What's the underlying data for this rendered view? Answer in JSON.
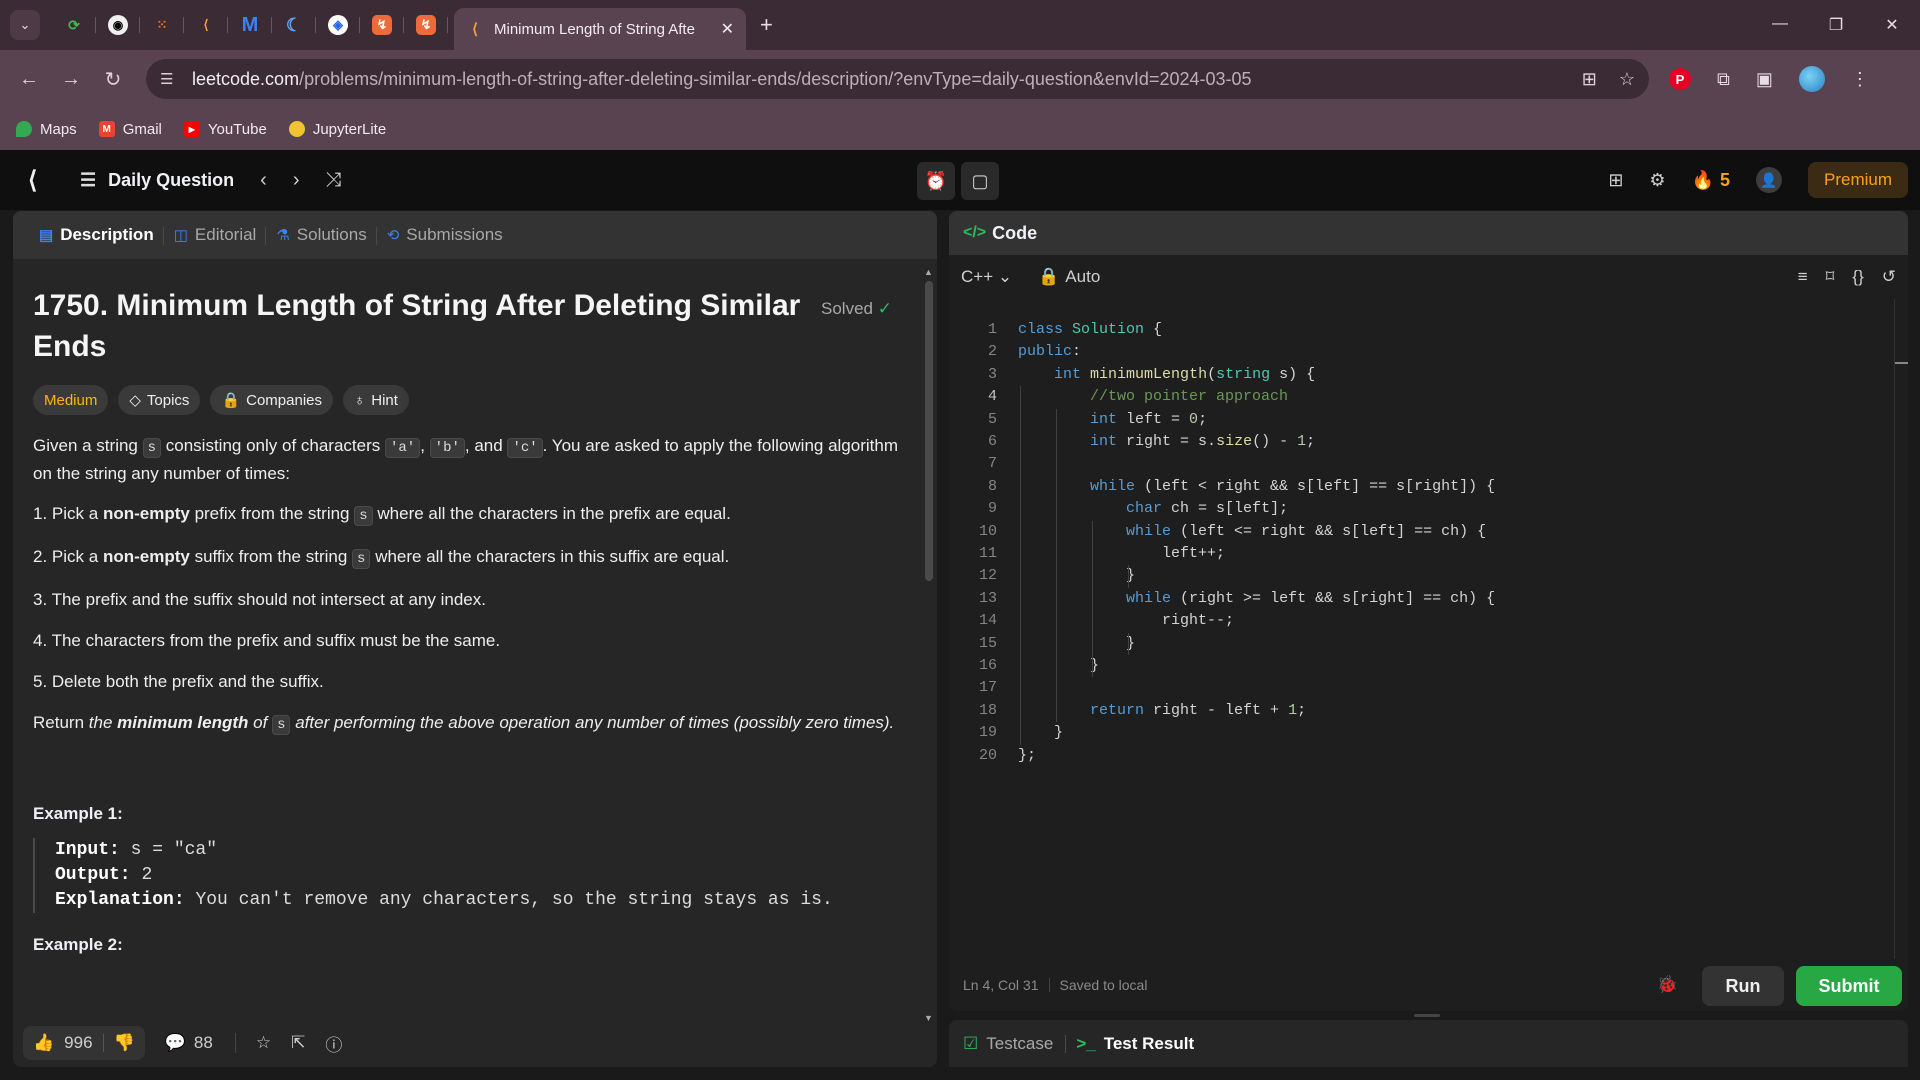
{
  "browser": {
    "tab_title": "Minimum Length of String Afte",
    "url_host": "leetcode.com",
    "url_path": "/problems/minimum-length-of-string-after-deleting-similar-ends/description/?envType=daily-question&envId=2024-03-05",
    "bookmarks": [
      "Maps",
      "Gmail",
      "YouTube",
      "JupyterLite"
    ]
  },
  "header": {
    "title": "Daily Question",
    "streak": "5",
    "premium": "Premium"
  },
  "left_tabs": [
    "Description",
    "Editorial",
    "Solutions",
    "Submissions"
  ],
  "problem": {
    "title": "1750. Minimum Length of String After Deleting Similar Ends",
    "status": "Solved",
    "difficulty": "Medium",
    "chips": [
      "Topics",
      "Companies",
      "Hint"
    ],
    "intro_1": "Given a string",
    "intro_s": "s",
    "intro_2": "consisting only of characters",
    "ch_a": "'a'",
    "ch_b": "'b'",
    "intro_and": ", and",
    "ch_c": "'c'",
    "intro_3": ". You are asked to apply the following algorithm on the string any number of times:",
    "s1_a": "1. Pick a",
    "s1_b": "non-empty",
    "s1_c": "prefix from the string",
    "s1_d": "where all the characters in the prefix are equal.",
    "s2_a": "2. Pick a",
    "s2_b": "non-empty",
    "s2_c": "suffix from the string",
    "s2_d": "where all the characters in this suffix are equal.",
    "s3": "3. The prefix and the suffix should not intersect at any index.",
    "s4": "4. The characters from the prefix and suffix must be the same.",
    "s5": "5. Delete both the prefix and the suffix.",
    "ret_a": "Return",
    "ret_b": "the",
    "ret_c": "minimum length",
    "ret_d": "of",
    "ret_e": "after performing the above operation any number of times (possibly zero times).",
    "ex1_title": "Example 1:",
    "ex1_input_label": "Input:",
    "ex1_input": "s = \"ca\"",
    "ex1_output_label": "Output:",
    "ex1_output": "2",
    "ex1_expl_label": "Explanation:",
    "ex1_expl": "You can't remove any characters, so the string stays as is.",
    "ex2_title": "Example 2:"
  },
  "footer": {
    "likes": "996",
    "comments": "88"
  },
  "editor": {
    "tab": "Code",
    "language": "C++",
    "mode": "Auto",
    "status_pos": "Ln 4, Col 31",
    "status_saved": "Saved to local",
    "run": "Run",
    "submit": "Submit",
    "current_line": 4,
    "lines": [
      "class Solution {",
      "public:",
      "    int minimumLength(string s) {",
      "        //two pointer approach",
      "        int left = 0;",
      "        int right = s.size() - 1;",
      "",
      "        while (left < right && s[left] == s[right]) {",
      "            char ch = s[left];",
      "            while (left <= right && s[left] == ch) {",
      "                left++;",
      "            }",
      "            while (right >= left && s[right] == ch) {",
      "                right--;",
      "            }",
      "        }",
      "",
      "        return right - left + 1;",
      "    }",
      "};"
    ]
  },
  "bottom_tabs": [
    "Testcase",
    "Test Result"
  ]
}
